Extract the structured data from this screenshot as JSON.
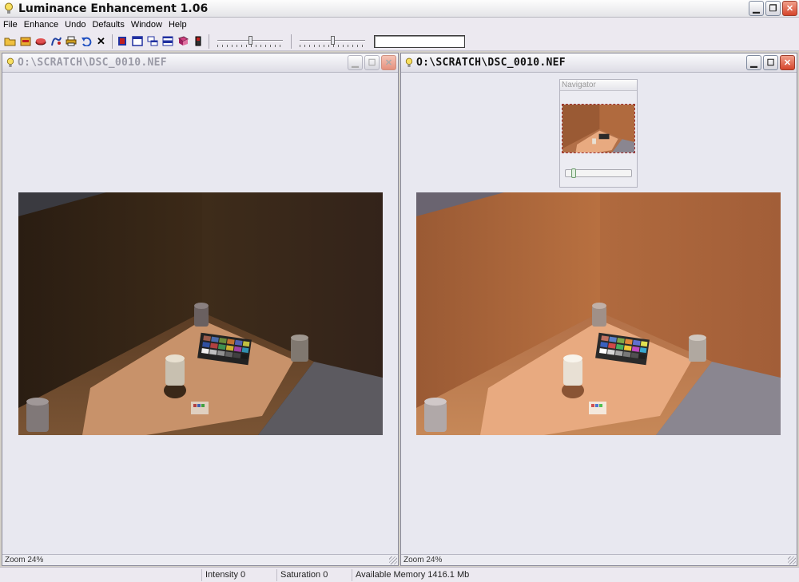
{
  "app": {
    "title": "Luminance Enhancement 1.06",
    "icon": "lightbulb-icon"
  },
  "menu": [
    "File",
    "Enhance",
    "Undo",
    "Defaults",
    "Window",
    "Help"
  ],
  "toolbar": {
    "buttons": [
      "open-icon",
      "save-icon",
      "eraser-icon",
      "curve-icon",
      "print-icon",
      "undo-icon",
      "close-icon",
      "flag-icon",
      "single-view-icon",
      "cascade-icon",
      "tile-icon",
      "book-icon",
      "phone-icon"
    ],
    "slider_intensity_value": 0,
    "slider_saturation_value": 0,
    "text_field_value": ""
  },
  "windows": {
    "left": {
      "title": "O:\\SCRATCH\\DSC_0010.NEF",
      "zoom": "Zoom 24%",
      "state": "inactive"
    },
    "right": {
      "title": "O:\\SCRATCH\\DSC_0010.NEF",
      "zoom": "Zoom 24%",
      "state": "active"
    }
  },
  "navigator": {
    "title": "Navigator",
    "zoom_slider_value": 0.05
  },
  "status": {
    "blank": "",
    "intensity": "Intensity 0",
    "saturation": "Saturation 0",
    "memory": "Available Memory 1416.1 Mb"
  },
  "colors": {
    "original_wall": "#3a2a1a",
    "enhanced_wall": "#b06a3a",
    "close_red": "#d5452b"
  }
}
